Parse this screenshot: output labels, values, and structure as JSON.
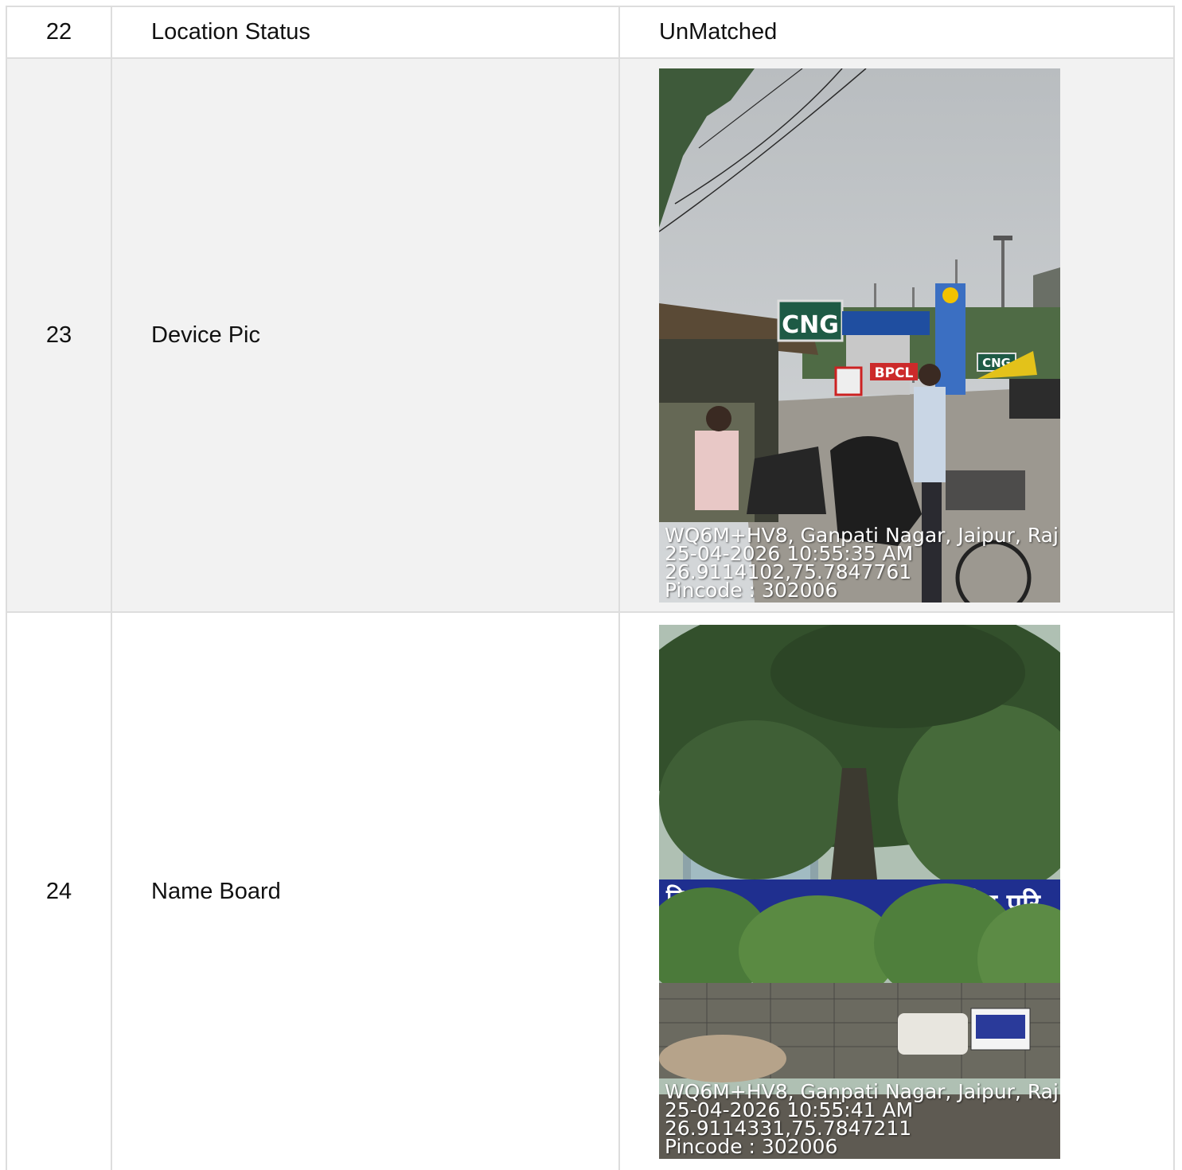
{
  "rows": [
    {
      "number": "22",
      "label": "Location Status",
      "value": "UnMatched"
    },
    {
      "number": "23",
      "label": "Device Pic",
      "photo": {
        "sign_cng": "CNG",
        "sign_brand": "BPCL",
        "sign_cng_small": "CNG",
        "stamp": {
          "address": "WQ6M+HV8, Ganpati Nagar, Jaipur, Raj",
          "datetime": "25-04-2026 10:55:35 AM",
          "coords": "26.9114102,75.7847761",
          "pincode": "Pincode : 302006"
        }
      }
    },
    {
      "number": "24",
      "label": "Name Board",
      "photo": {
        "board_text": "क्षेत्रीय परि",
        "board_text_left": "दि",
        "stamp": {
          "address": "WQ6M+HV8, Ganpati Nagar, Jaipur, Raj",
          "datetime": "25-04-2026 10:55:41 AM",
          "coords": "26.9114331,75.7847211",
          "pincode": "Pincode : 302006"
        }
      }
    }
  ]
}
